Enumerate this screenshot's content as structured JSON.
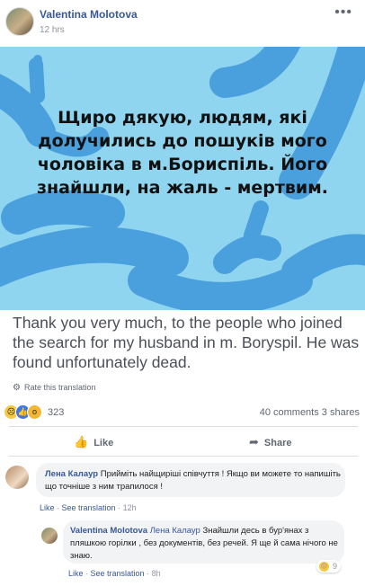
{
  "post": {
    "author": "Valentina Molotova",
    "time": "12 hrs",
    "more_label": "•••",
    "banner_text": "Щиро дякую, людям, які долучились до пошуків мого чоловіка в м.Бориспіль. Його знайшли, на жаль - мертвим.",
    "translation": "Thank you very much, to the people who joined the search for my husband in m. Boryspil. He was found unfortunately dead.",
    "rate_translation": "Rate this translation",
    "reaction_count": "323",
    "comments_count": "40 comments",
    "shares_count": "3 shares",
    "like_label": "Like",
    "share_label": "Share",
    "colors": {
      "banner": "#8fd5ef",
      "banner_shapes": "#4a9fdd",
      "link": "#385898"
    },
    "icons": [
      "gear-icon",
      "sad-reaction-icon",
      "like-reaction-icon",
      "wow-reaction-icon",
      "thumbs-up-icon",
      "share-arrow-icon"
    ]
  },
  "comments": [
    {
      "author": "Лена Калаур",
      "text": "Прийміть найщиріші співчуття ! Якщо ви можете то напишіть що точніше з ним трапилося !",
      "like": "Like",
      "see_translation": "See translation",
      "time": "12h"
    },
    {
      "author": "Valentina Molotova",
      "mention": "Лена Калаур",
      "text": "Знайшли десь в бур'янах з пляшкою горілки , без документів, без речей. Я ще й сама нічого не знаю.",
      "like": "Like",
      "see_translation": "See translation",
      "time": "8h",
      "reaction_count": "9"
    }
  ]
}
